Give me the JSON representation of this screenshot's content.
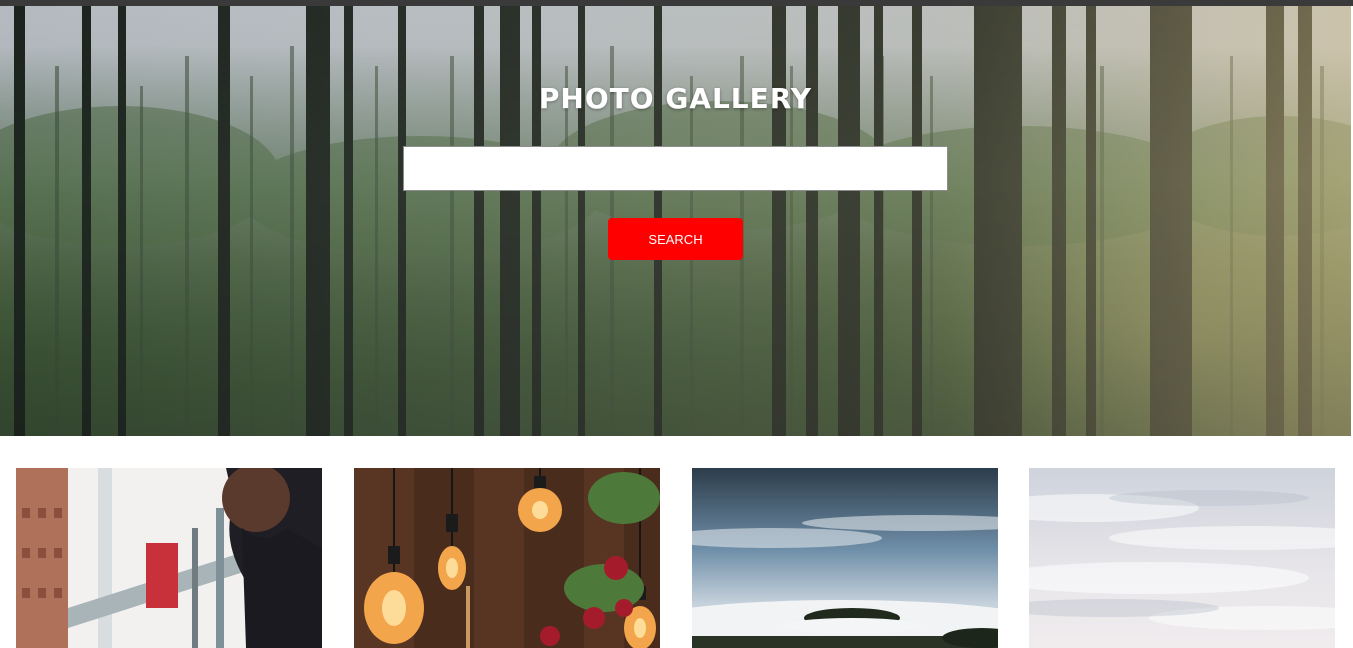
{
  "hero": {
    "title": "PHOTO GALLERY",
    "search": {
      "value": "",
      "placeholder": ""
    },
    "search_button_label": "SEARCH",
    "background_icon": "forest-photo"
  },
  "gallery": {
    "items": [
      {
        "name": "person-bridge-photo"
      },
      {
        "name": "edison-bulbs-photo"
      },
      {
        "name": "foggy-island-photo"
      },
      {
        "name": "cloudy-sky-photo"
      }
    ]
  },
  "colors": {
    "button": "#ff0000",
    "button_text": "#ffffff",
    "title": "#ffffff",
    "page_background": "#ffffff"
  }
}
